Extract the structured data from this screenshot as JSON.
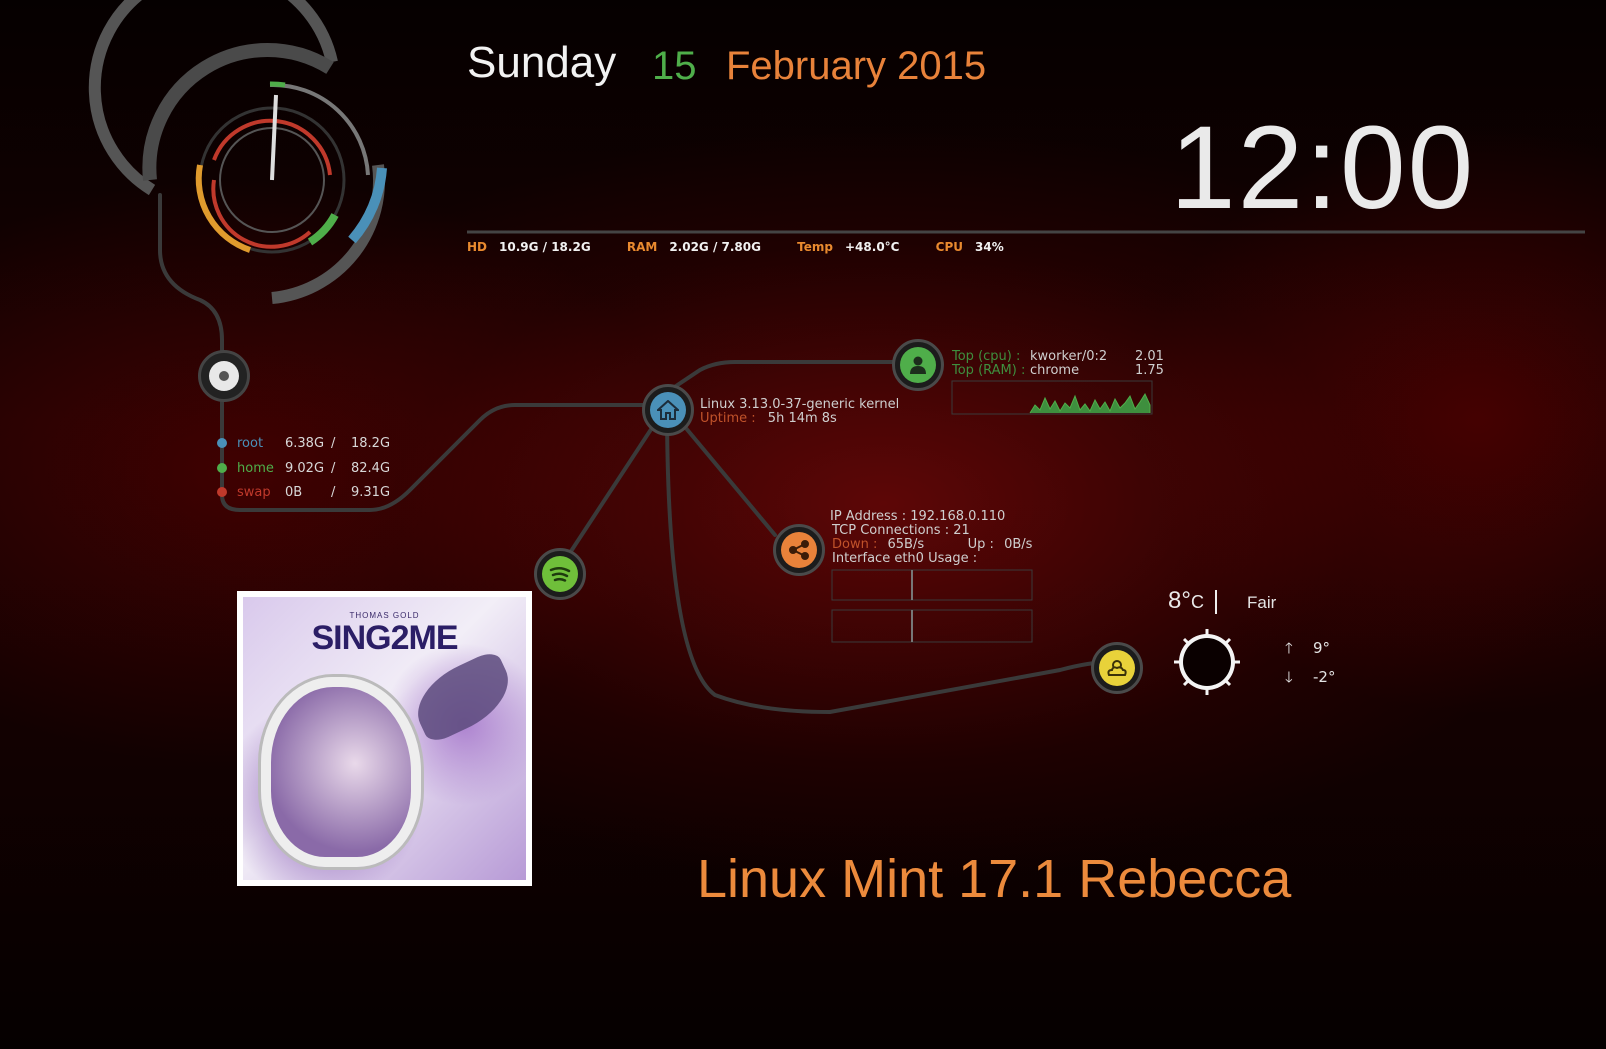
{
  "date": {
    "weekday": "Sunday",
    "day": "15",
    "month_year": "February 2015"
  },
  "clock": {
    "time": "12:00"
  },
  "sysbar": {
    "hd_label": "HD",
    "hd_value": "10.9G / 18.2G",
    "ram_label": "RAM",
    "ram_value": "2.02G / 7.80G",
    "temp_label": "Temp",
    "temp_value": "+48.0°C",
    "cpu_label": "CPU",
    "cpu_value": "34%"
  },
  "disks": [
    {
      "name": "root",
      "used": "6.38G",
      "sep": "/",
      "total": "18.2G"
    },
    {
      "name": "home",
      "used": "9.02G",
      "sep": "/",
      "total": "82.4G"
    },
    {
      "name": "swap",
      "used": "0B",
      "sep": "/",
      "total": "9.31G"
    }
  ],
  "system": {
    "kernel": "Linux 3.13.0-37-generic kernel",
    "uptime_label": "Uptime :",
    "uptime": "5h 14m 8s"
  },
  "top": {
    "cpu_label": "Top (cpu) :",
    "cpu_proc": "kworker/0:2",
    "cpu_val": "2.01",
    "ram_label": "Top (RAM) :",
    "ram_proc": "chrome",
    "ram_val": "1.75"
  },
  "network": {
    "ip": "IP Address : 192.168.0.110",
    "tcp": "TCP Connections : 21",
    "down_label": "Down :",
    "down_val": "65B/s",
    "up_label": "Up :",
    "up_val": "0B/s",
    "interface": "Interface eth0 Usage :"
  },
  "album": {
    "artist": "THOMAS GOLD",
    "title": "SING2ME"
  },
  "weather": {
    "temp": "8°",
    "unit": "C",
    "condition": "Fair",
    "high": "9°",
    "low": "-2°"
  },
  "os": {
    "name": "Linux Mint 17.1 Rebecca"
  },
  "colors": {
    "orange": "#e8823a",
    "green": "#4fae4a",
    "blue": "#4a90b8",
    "red": "#c0392b",
    "yellow": "#e8d23a"
  },
  "icons": [
    "power-icon",
    "home-icon",
    "user-icon",
    "share-icon",
    "spotify-icon",
    "weather-cloud-icon",
    "sun-icon",
    "arrow-up-icon",
    "arrow-down-icon"
  ]
}
